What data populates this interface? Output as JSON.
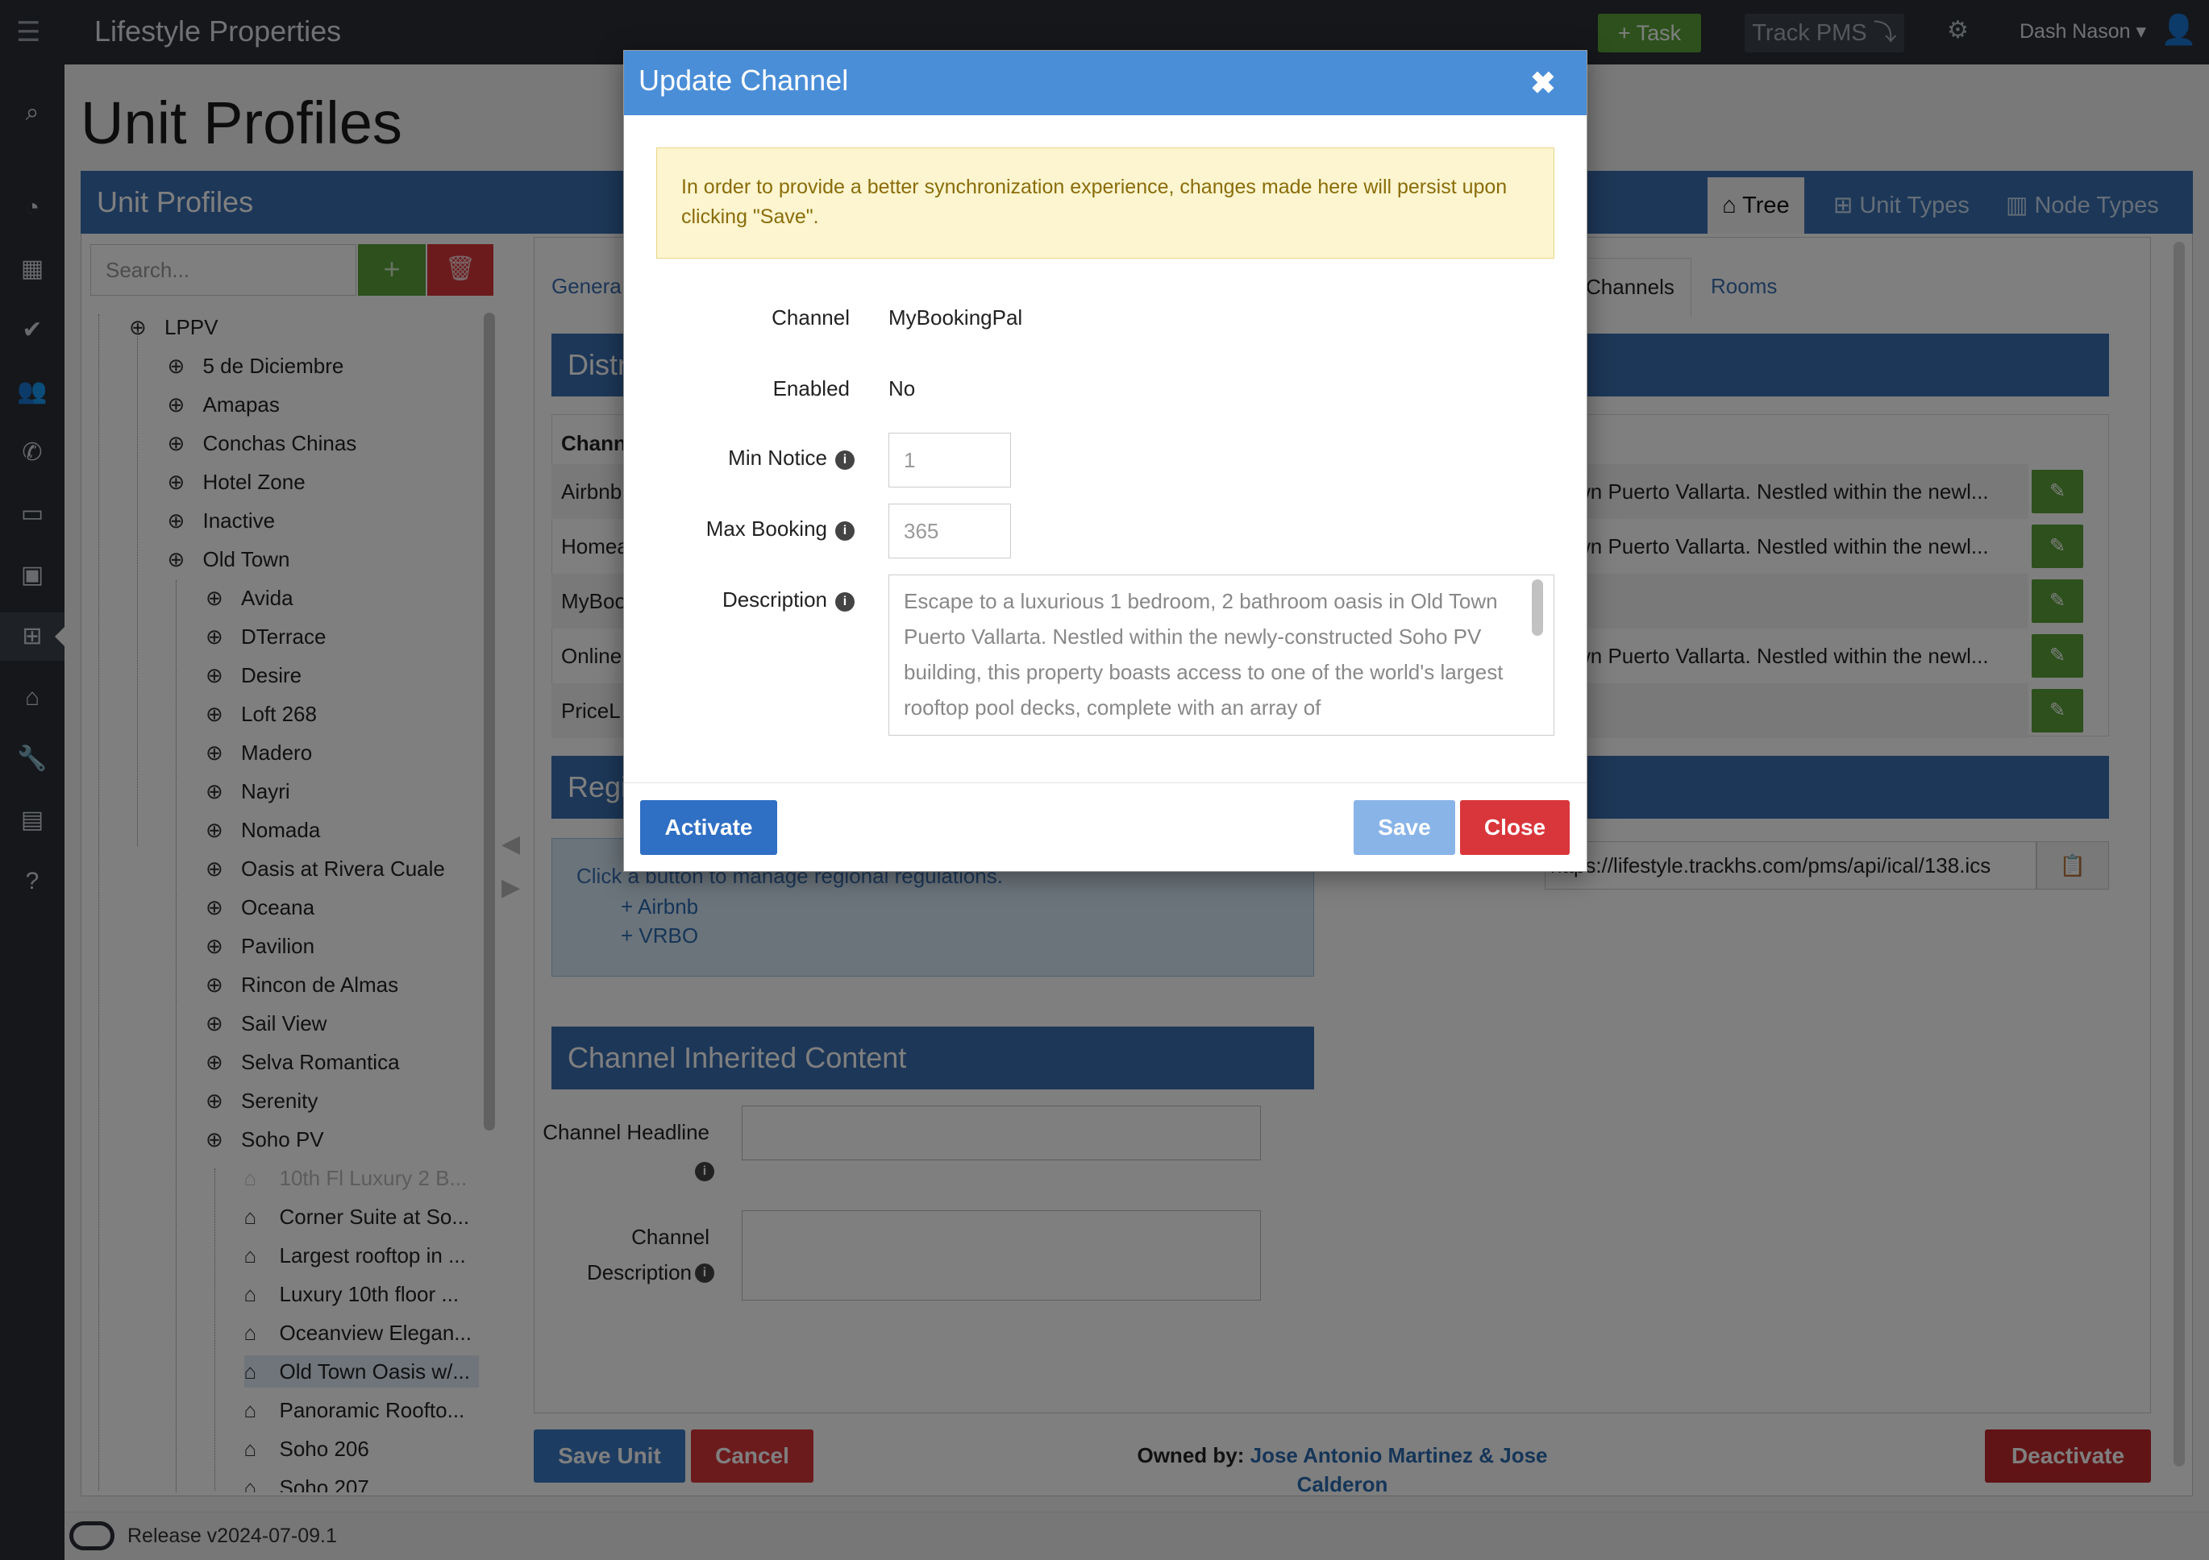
{
  "topbar": {
    "brand": "Lifestyle Properties",
    "task_label": "+ Task",
    "track_label": "Track PMS ⤵",
    "user": "Dash Nason ▾"
  },
  "page": {
    "title": "Unit Profiles"
  },
  "panel": {
    "title": "Unit Profiles",
    "tabs": [
      "Tree",
      "Unit Types",
      "Node Types"
    ]
  },
  "tree": {
    "search_placeholder": "Search...",
    "items": [
      {
        "label": "LPPV",
        "level": 0,
        "icon": "globe-icon"
      },
      {
        "label": "5 de Diciembre",
        "level": 1,
        "icon": "globe-icon"
      },
      {
        "label": "Amapas",
        "level": 1,
        "icon": "globe-icon"
      },
      {
        "label": "Conchas Chinas",
        "level": 1,
        "icon": "globe-icon"
      },
      {
        "label": "Hotel Zone",
        "level": 1,
        "icon": "globe-icon"
      },
      {
        "label": "Inactive",
        "level": 1,
        "icon": "globe-icon"
      },
      {
        "label": "Old Town",
        "level": 1,
        "icon": "globe-icon"
      },
      {
        "label": "Avida",
        "level": 2,
        "icon": "globe-icon"
      },
      {
        "label": "DTerrace",
        "level": 2,
        "icon": "globe-icon"
      },
      {
        "label": "Desire",
        "level": 2,
        "icon": "globe-icon"
      },
      {
        "label": "Loft 268",
        "level": 2,
        "icon": "globe-icon"
      },
      {
        "label": "Madero",
        "level": 2,
        "icon": "globe-icon"
      },
      {
        "label": "Nayri",
        "level": 2,
        "icon": "globe-icon"
      },
      {
        "label": "Nomada",
        "level": 2,
        "icon": "globe-icon"
      },
      {
        "label": "Oasis at Rivera Cuale",
        "level": 2,
        "icon": "globe-icon"
      },
      {
        "label": "Oceana",
        "level": 2,
        "icon": "globe-icon"
      },
      {
        "label": "Pavilion",
        "level": 2,
        "icon": "globe-icon"
      },
      {
        "label": "Rincon de Almas",
        "level": 2,
        "icon": "globe-icon"
      },
      {
        "label": "Sail View",
        "level": 2,
        "icon": "globe-icon"
      },
      {
        "label": "Selva Romantica",
        "level": 2,
        "icon": "globe-icon"
      },
      {
        "label": "Serenity",
        "level": 2,
        "icon": "globe-icon"
      },
      {
        "label": "Soho PV",
        "level": 2,
        "icon": "globe-icon"
      },
      {
        "label": "10th Fl Luxury 2 B...",
        "level": 3,
        "icon": "home-icon",
        "dim": true
      },
      {
        "label": "Corner Suite at So...",
        "level": 3,
        "icon": "home-icon"
      },
      {
        "label": "Largest rooftop in ...",
        "level": 3,
        "icon": "home-icon"
      },
      {
        "label": "Luxury 10th floor ...",
        "level": 3,
        "icon": "home-icon"
      },
      {
        "label": "Oceanview Elegan...",
        "level": 3,
        "icon": "home-icon"
      },
      {
        "label": "Old Town Oasis w/...",
        "level": 3,
        "icon": "home-icon",
        "selected": true
      },
      {
        "label": "Panoramic Roofto...",
        "level": 3,
        "icon": "home-icon"
      },
      {
        "label": "Soho 206",
        "level": 3,
        "icon": "home-icon"
      },
      {
        "label": "Soho 207",
        "level": 3,
        "icon": "home-icon"
      }
    ]
  },
  "content": {
    "tabs": [
      "Genera",
      "Channels",
      "Rooms"
    ],
    "dist_title": "Distr",
    "table_header": "Chann",
    "rows": [
      {
        "name": "Airbnb",
        "desc": "wn Puerto Vallarta. Nestled within the newl..."
      },
      {
        "name": "Homea",
        "desc": "wn Puerto Vallarta. Nestled within the newl..."
      },
      {
        "name": "MyBoo",
        "desc": ""
      },
      {
        "name": "Online",
        "desc": "wn Puerto Vallarta. Nestled within the newl..."
      },
      {
        "name": "PriceL",
        "desc": ""
      }
    ],
    "reg_title": "Regi",
    "reg_text": "Click a button to manage regional regulations.",
    "reg_links": [
      "+ Airbnb",
      "+ VRBO"
    ],
    "ical_url": "https://lifestyle.trackhs.com/pms/api/ical/138.ics",
    "inherited_title": "Channel Inherited Content",
    "headline_label": "Channel Headline",
    "desc_label_1": "Channel",
    "desc_label_2": "Description",
    "save_unit": "Save Unit",
    "cancel": "Cancel",
    "owned_label": "Owned by:",
    "owner_1": "Jose Antonio Martinez & Jose",
    "owner_2": "Calderon",
    "deactivate": "Deactivate"
  },
  "footer": {
    "release": "Release v2024-07-09.1"
  },
  "modal": {
    "title": "Update Channel",
    "alert": "In order to provide a better synchronization experience, changes made here will persist upon clicking \"Save\".",
    "channel_label": "Channel",
    "channel_value": "MyBookingPal",
    "enabled_label": "Enabled",
    "enabled_value": "No",
    "min_notice_label": "Min Notice",
    "min_notice_value": "1",
    "max_booking_label": "Max Booking",
    "max_booking_value": "365",
    "description_label": "Description",
    "description_value": "Escape to a luxurious 1 bedroom, 2 bathroom oasis in Old Town Puerto Vallarta. Nestled within the newly-constructed Soho PV building, this property boasts access to one of the world's largest rooftop pool decks, complete with an array of",
    "activate": "Activate",
    "save": "Save",
    "close": "Close"
  },
  "colors": {
    "primary": "#3a6fb0",
    "success": "#5aa139",
    "danger": "#d9363b",
    "modal_header": "#4a8ed8"
  }
}
